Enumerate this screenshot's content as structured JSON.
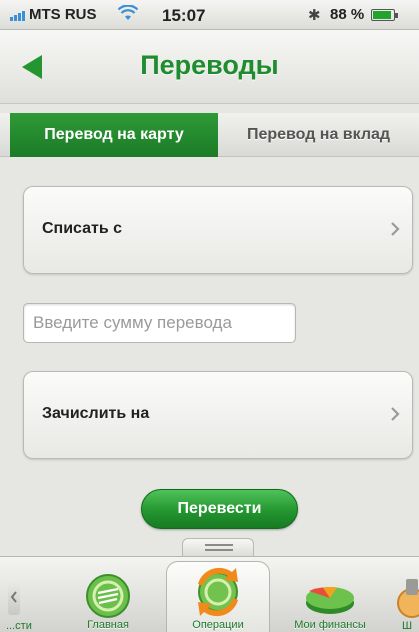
{
  "status_bar": {
    "carrier": "MTS RUS",
    "time": "15:07",
    "battery": "88 %",
    "battery_level": 0.88,
    "icons": [
      "signal-icon",
      "wifi-icon",
      "bluetooth-icon",
      "battery-icon"
    ]
  },
  "nav": {
    "title": "Переводы",
    "back_icon": "back-arrow-icon"
  },
  "tabs": [
    {
      "label": "Перевод на карту",
      "active": true
    },
    {
      "label": "Перевод на вклад",
      "active": false
    }
  ],
  "form": {
    "from_label": "Списать с",
    "amount_placeholder": "Введите сумму перевода",
    "amount_value": "",
    "to_label": "Зачислить на",
    "submit_label": "Перевести"
  },
  "tabbar": {
    "left_clipped_label": "...сти",
    "items": [
      {
        "label": "Главная",
        "icon": "sberbank-logo-icon"
      },
      {
        "label": "Операции",
        "icon": "operations-icon",
        "active": true
      },
      {
        "label": "Мои финансы",
        "icon": "pie-chart-icon"
      }
    ],
    "right_clipped_label": "Ш"
  },
  "colors": {
    "brand_green": "#1e8c2f",
    "button_green": "#23962f",
    "background": "#e6e6e3"
  }
}
